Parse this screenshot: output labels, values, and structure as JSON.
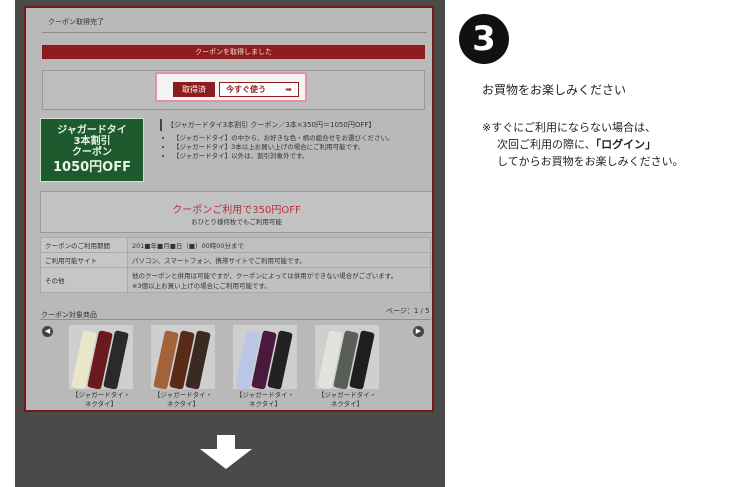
{
  "screen": {
    "breadcrumb": "クーポン取得完了",
    "banner": "クーポンを取得しました",
    "acquired_label": "取得済",
    "use_now_label": "今すぐ使う",
    "coupon_badge": {
      "line1": "ジャガードタイ",
      "line2": "3本割引",
      "line3": "クーポン",
      "amount": "1050円OFF"
    },
    "coupon_title": "【ジャガードタイ3本割引 クーポン／3本×350円＝1050円OFF】",
    "conditions": [
      "【ジャガードタイ】の中から、お好きな色・柄の組合せをお選びください。",
      "【ジャガードタイ】3本以上お買い上げの場合にご利用可能です。",
      "【ジャガードタイ】以外は、割引対象外です。"
    ],
    "usage_main": "クーポンご利用で350円OFF",
    "usage_sub": "おひとり様何枚でもご利用可能",
    "info_rows": [
      {
        "key": "クーポンのご利用期間",
        "value": "201■年■月■日（■）00時00分まで"
      },
      {
        "key": "ご利用可能サイト",
        "value": "パソコン、スマートフォン、携帯サイトでご利用可能です。"
      },
      {
        "key": "その他",
        "value": "他のクーポンと併用は可能ですが、クーポンによっては併用ができない場合がございます。",
        "value2": "※3個以上お買い上げの場合にご利用可能です。"
      }
    ],
    "products_title": "クーポン対象商品",
    "products_page": "ページ：1 / 5",
    "products": [
      {
        "caption1": "【ジャガードタイ・",
        "caption2": "ネクタイ】"
      },
      {
        "caption1": "【ジャガードタイ・",
        "caption2": "ネクタイ】"
      },
      {
        "caption1": "【ジャガードタイ・",
        "caption2": "ネクタイ】"
      },
      {
        "caption1": "【ジャガードタイ・",
        "caption2": "ネクタイ】"
      }
    ]
  },
  "step": {
    "number": "3",
    "enjoy": "お買物をお楽しみください",
    "note_line1": "※すぐにご利用にならない場合は、",
    "note_line2_pre": "次回ご利用の際に、",
    "note_line2_bold": "「ログイン」",
    "note_line3": "してからお買物をお楽しみください。"
  },
  "colors": {
    "accent_red": "#8e1c1c",
    "badge_green": "#1d5a2d",
    "frame_dark": "#4a4a4a"
  },
  "icons": [
    "arrow-right-icon",
    "arrow-down-icon",
    "prev-circle-icon",
    "next-circle-icon"
  ]
}
